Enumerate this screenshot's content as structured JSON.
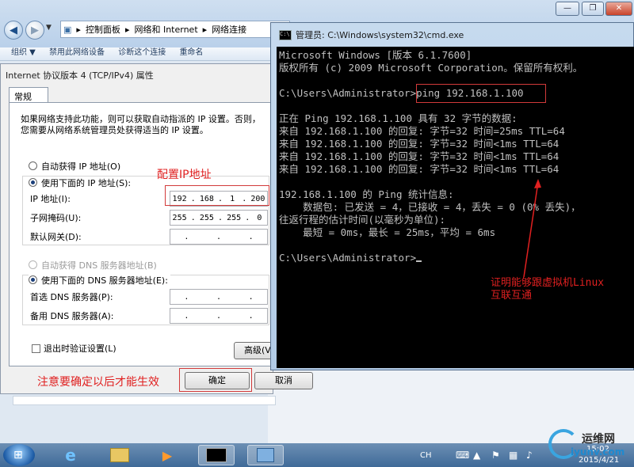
{
  "explorer": {
    "address": [
      "控制面板",
      "网络和 Internet",
      "网络连接"
    ],
    "toolbar": [
      "组织 ▼",
      "禁用此网络设备",
      "诊断这个连接",
      "重命名"
    ]
  },
  "dialog": {
    "title": "Internet 协议版本 4 (TCP/IPv4) 属性",
    "tab": "常规",
    "description": [
      "如果网络支持此功能，则可以获取自动指派的 IP 设置。否则，",
      "您需要从网络系统管理员处获得适当的 IP 设置。"
    ],
    "auto_ip": "自动获得 IP 地址(O)",
    "manual_ip": "使用下面的 IP 地址(S):",
    "ip_label": "IP 地址(I):",
    "ip_value": [
      "192",
      "168",
      "1",
      "200"
    ],
    "mask_label": "子网掩码(U):",
    "mask_value": [
      "255",
      "255",
      "255",
      "0"
    ],
    "gateway_label": "默认网关(D):",
    "auto_dns": "自动获得 DNS 服务器地址(B)",
    "manual_dns": "使用下面的 DNS 服务器地址(E):",
    "dns1_label": "首选 DNS 服务器(P):",
    "dns2_label": "备用 DNS 服务器(A):",
    "validate": "退出时验证设置(L)",
    "advanced": "高级(V)...",
    "ok": "确定",
    "cancel": "取消"
  },
  "annotations": {
    "config_ip": "配置IP地址",
    "note_ok": "注意要确定以后才能生效",
    "proof": [
      "证明能够跟虚拟机Linux",
      "互联互通"
    ]
  },
  "cmd": {
    "title": "管理员: C:\\Windows\\system32\\cmd.exe",
    "lines": [
      "Microsoft Windows [版本 6.1.7600]",
      "版权所有 (c) 2009 Microsoft Corporation。保留所有权利。",
      "",
      "C:\\Users\\Administrator>ping 192.168.1.100",
      "",
      "正在 Ping 192.168.1.100 具有 32 字节的数据:",
      "来自 192.168.1.100 的回复: 字节=32 时间=25ms TTL=64",
      "来自 192.168.1.100 的回复: 字节=32 时间<1ms TTL=64",
      "来自 192.168.1.100 的回复: 字节=32 时间<1ms TTL=64",
      "来自 192.168.1.100 的回复: 字节=32 时间<1ms TTL=64",
      "",
      "192.168.1.100 的 Ping 统计信息:",
      "    数据包: 已发送 = 4，已接收 = 4，丢失 = 0 (0% 丢失)，",
      "往返行程的估计时间(以毫秒为单位):",
      "    最短 = 0ms，最长 = 25ms，平均 = 6ms",
      "",
      "C:\\Users\\Administrator>"
    ]
  },
  "taskbar": {
    "lang": "CH",
    "date": "2015/4/21",
    "time": "15:02"
  },
  "watermark": {
    "text": "运维网",
    "url": "iyunv.com"
  }
}
